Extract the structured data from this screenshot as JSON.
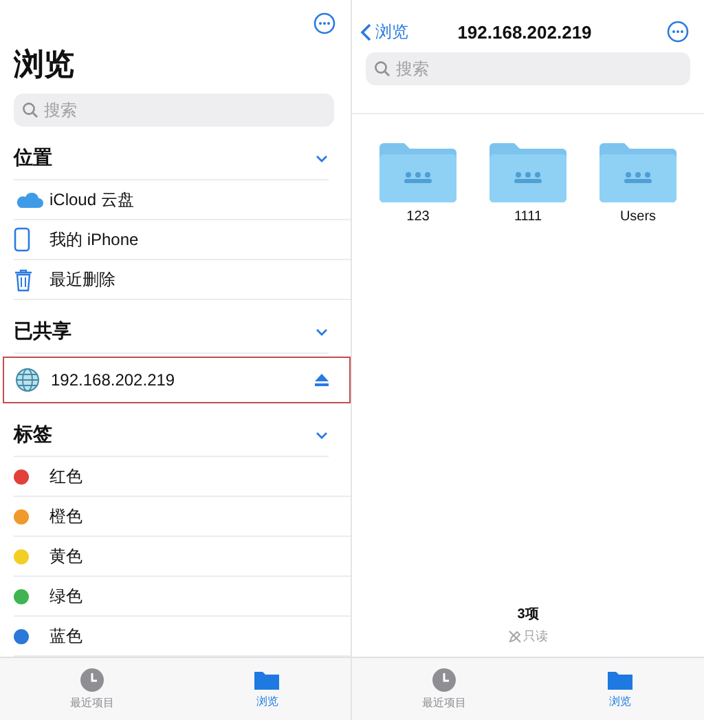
{
  "left": {
    "title": "浏览",
    "search": {
      "placeholder": "搜索"
    },
    "sections": [
      {
        "title": "位置",
        "expanded": true,
        "items": [
          {
            "kind": "cloud",
            "label": "iCloud 云盘",
            "selected": false
          },
          {
            "kind": "phone",
            "label": "我的 iPhone",
            "selected": false
          },
          {
            "kind": "trash",
            "label": "最近删除",
            "selected": false
          }
        ]
      },
      {
        "title": "已共享",
        "expanded": true,
        "items": [
          {
            "kind": "server",
            "label": "192.168.202.219",
            "selected": true
          }
        ]
      },
      {
        "title": "标签",
        "expanded": true,
        "items": [
          {
            "kind": "tag",
            "label": "红色",
            "color": "#e2403a"
          },
          {
            "kind": "tag",
            "label": "橙色",
            "color": "#ef9a2a"
          },
          {
            "kind": "tag",
            "label": "黄色",
            "color": "#f2cf25"
          },
          {
            "kind": "tag",
            "label": "绿色",
            "color": "#3fb450"
          },
          {
            "kind": "tag",
            "label": "蓝色",
            "color": "#2a78d8"
          }
        ]
      }
    ],
    "tab_bar": [
      {
        "kind": "recent",
        "label": "最近项目",
        "selected": false
      },
      {
        "kind": "browse",
        "label": "浏览",
        "selected": true
      }
    ]
  },
  "right": {
    "back": "浏览",
    "title": "192.168.202.219",
    "search": {
      "placeholder": "搜索"
    },
    "folders": [
      {
        "name": "123"
      },
      {
        "name": "1111"
      },
      {
        "name": "Users"
      }
    ],
    "footer": {
      "count": "3项",
      "status": "只读"
    },
    "tab_bar": [
      {
        "kind": "recent",
        "label": "最近项目",
        "selected": false
      },
      {
        "kind": "browse",
        "label": "浏览",
        "selected": true
      }
    ]
  }
}
